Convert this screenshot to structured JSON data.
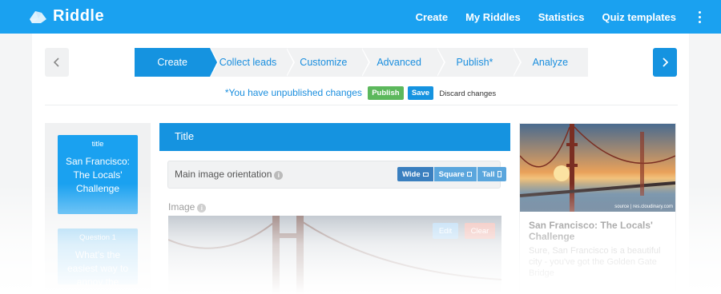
{
  "brand": {
    "name": "Riddle"
  },
  "nav": {
    "items": [
      "Create",
      "My Riddles",
      "Statistics",
      "Quiz templates"
    ]
  },
  "steps": [
    "Create",
    "Collect leads",
    "Customize",
    "Advanced",
    "Publish*",
    "Analyze"
  ],
  "status": {
    "message": "*You have unpublished changes",
    "publish_label": "Publish",
    "save_label": "Save",
    "discard_label": "Discard changes"
  },
  "sidebar": {
    "cards": [
      {
        "caption": "title",
        "text": "San Francisco: The Locals' Challenge"
      },
      {
        "caption": "Question 1",
        "text": "What's the easiest way to annoy the"
      }
    ]
  },
  "editor": {
    "header": "Title",
    "orientation_label": "Main image orientation",
    "orientation_options": [
      "Wide",
      "Square",
      "Tall"
    ],
    "orientation_selected": "Wide",
    "image_label": "Image",
    "edit_label": "Edit",
    "clear_label": "Clear"
  },
  "preview": {
    "title": "San Francisco: The Locals' Challenge",
    "body": "Sure, San Francisco is a beautiful city - you've got the Golden Gate Bridge",
    "credit": "source | res.cloudinary.com"
  },
  "colors": {
    "brand": "#1aa1f0",
    "accent": "#1593e0",
    "publish": "#5cb85c",
    "clear": "#eaa59b"
  }
}
